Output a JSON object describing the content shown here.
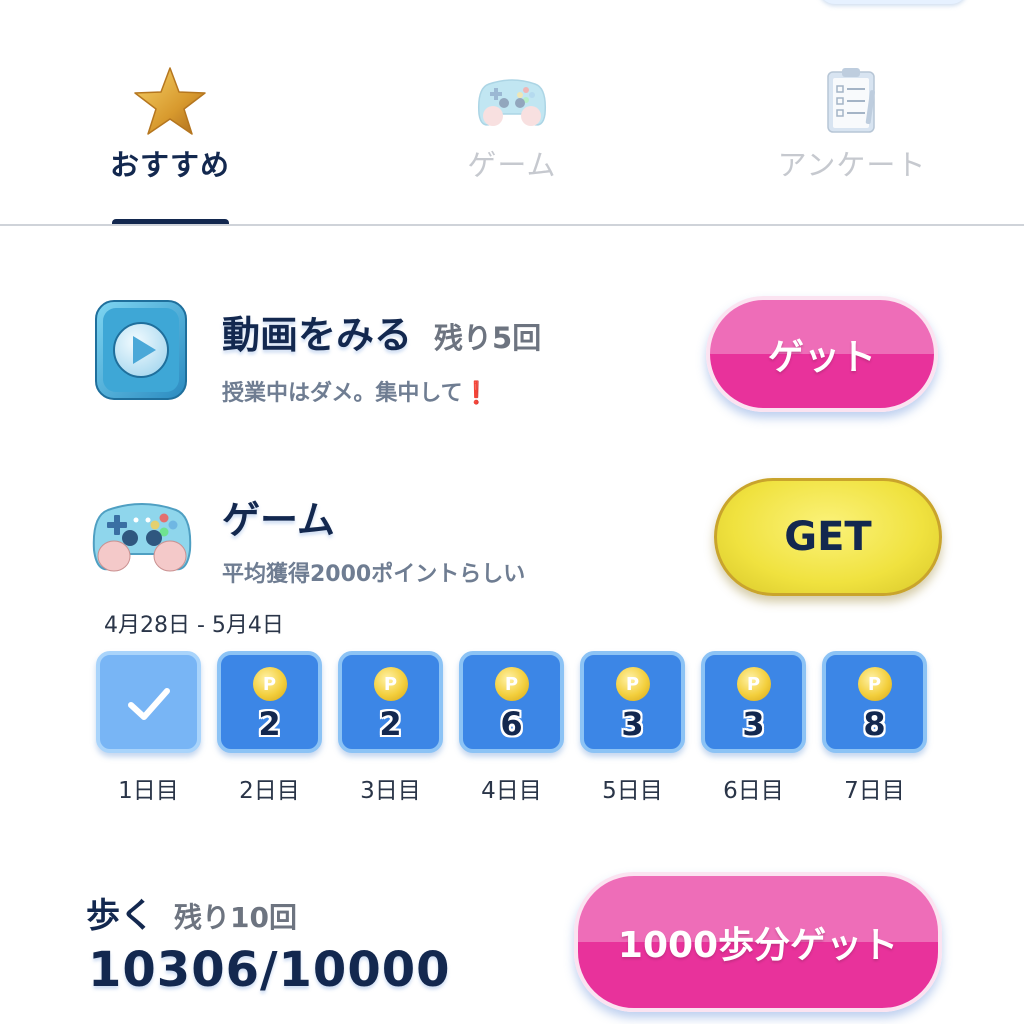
{
  "tabs": [
    {
      "label": "おすすめ",
      "icon": "star-icon",
      "active": true
    },
    {
      "label": "ゲーム",
      "icon": "gamepad-icon",
      "active": false
    },
    {
      "label": "アンケート",
      "icon": "clipboard-icon",
      "active": false
    }
  ],
  "video": {
    "title": "動画をみる",
    "remaining": "残り5回",
    "subtitle": "授業中はダメ。集中して",
    "exclamation": "❗",
    "button_label": "ゲット",
    "icon": "play-icon"
  },
  "game": {
    "title": "ゲーム",
    "subtitle": "平均獲得2000ポイントらしい",
    "button_label": "GET",
    "icon": "gamepad-icon"
  },
  "week": {
    "range": "4月28日 - 5月4日",
    "days": [
      {
        "label": "1日目",
        "points": null,
        "done": true
      },
      {
        "label": "2日目",
        "points": "2",
        "done": false
      },
      {
        "label": "3日目",
        "points": "2",
        "done": false
      },
      {
        "label": "4日目",
        "points": "6",
        "done": false
      },
      {
        "label": "5日目",
        "points": "3",
        "done": false
      },
      {
        "label": "6日目",
        "points": "3",
        "done": false
      },
      {
        "label": "7日目",
        "points": "8",
        "done": false
      }
    ],
    "coin_letter": "P"
  },
  "walk": {
    "title": "歩く",
    "remaining": "残り10回",
    "count": "10306/10000",
    "button_label": "1000歩分ゲット"
  },
  "colors": {
    "navy": "#13284f",
    "pink": "#e8329b",
    "yellow": "#f0e23f",
    "blue": "#3c86e6"
  }
}
